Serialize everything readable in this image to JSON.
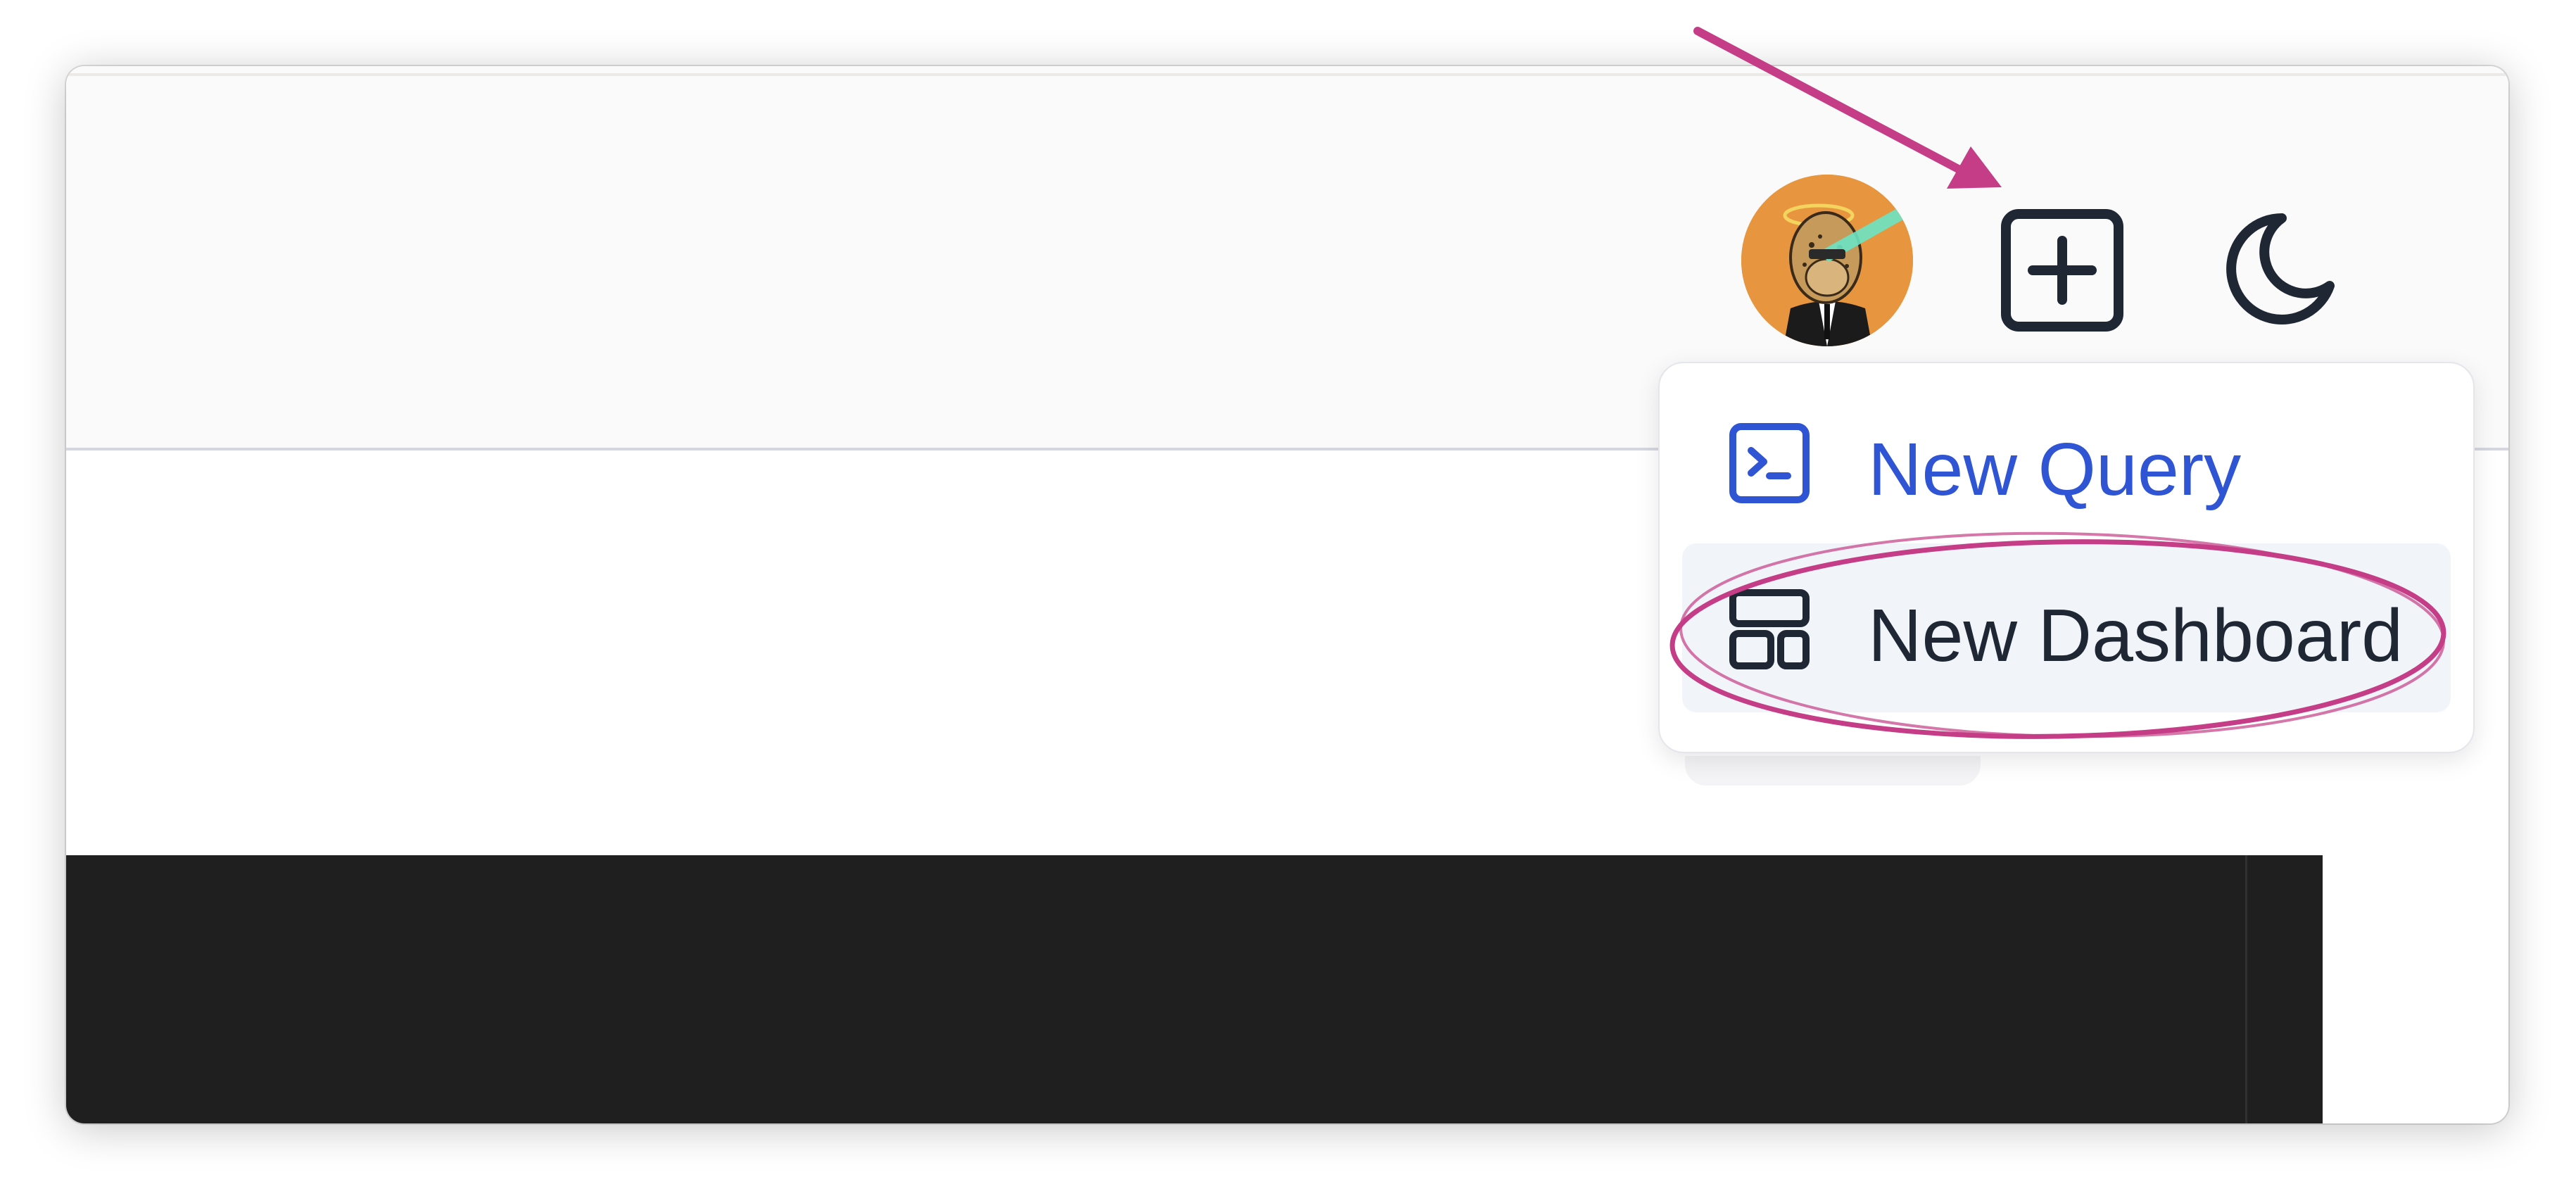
{
  "header": {
    "avatar": {
      "icon": "avatar-ape-icon",
      "bg_color": "#e7963f"
    },
    "new_button": {
      "icon": "plus-square-icon"
    },
    "theme_toggle": {
      "icon": "moon-icon"
    }
  },
  "dropdown": {
    "items": [
      {
        "label": "New Query",
        "icon": "terminal-icon",
        "color": "#2f55d4"
      },
      {
        "label": "New Dashboard",
        "icon": "layout-icon",
        "color": "#1f2735",
        "highlighted": true
      }
    ]
  },
  "annotation": {
    "arrow_color": "#c43d86",
    "circle_color": "#c43d86"
  },
  "theme": {
    "header_bg": "#fafafa",
    "dark_panel_bg": "#1f1f1f",
    "accent": "#2f55d4"
  }
}
